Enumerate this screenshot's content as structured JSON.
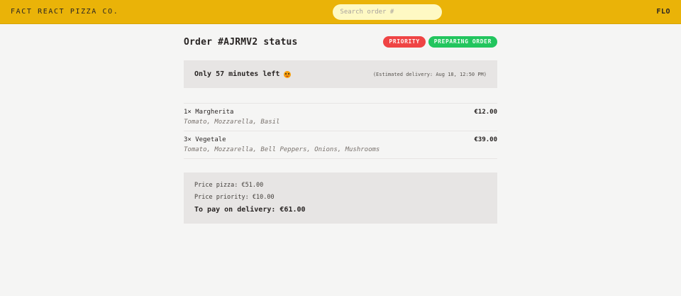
{
  "header": {
    "logo": "FACT REACT PIZZA CO.",
    "search_placeholder": "Search order #",
    "username": "FLO"
  },
  "order": {
    "title": "Order #AJRMV2 status",
    "badges": {
      "priority": "PRIORITY",
      "status": "PREPARING ORDER"
    },
    "eta": {
      "left": "Only 57 minutes left",
      "icon": "grinning-face-emoji",
      "estimated": "(Estimated delivery: Aug 18, 12:50 PM)"
    },
    "items": [
      {
        "name": "1× Margherita",
        "price": "€12.00",
        "ingredients": "Tomato, Mozzarella, Basil"
      },
      {
        "name": "3× Vegetale",
        "price": "€39.00",
        "ingredients": "Tomato, Mozzarella, Bell Peppers, Onions, Mushrooms"
      }
    ],
    "totals": {
      "price_pizza": "Price pizza: €51.00",
      "price_priority": "Price priority: €10.00",
      "to_pay": "To pay on delivery: €61.00"
    }
  },
  "colors": {
    "header": "#eab308",
    "priority": "#ef4444",
    "preparing": "#22c55e"
  }
}
